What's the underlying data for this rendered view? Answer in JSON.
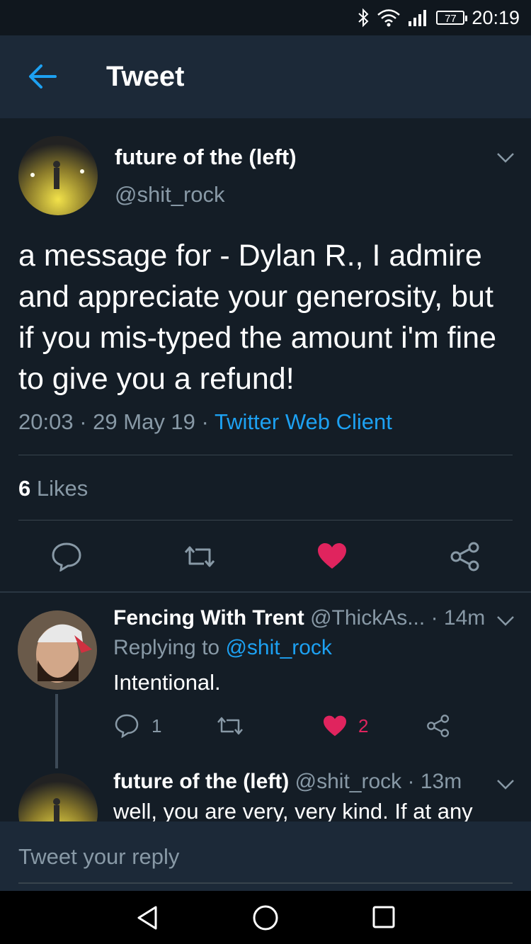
{
  "status_bar": {
    "bluetooth_icon": "bluetooth-icon",
    "wifi_icon": "wifi-icon",
    "signal_icon": "signal-icon",
    "battery": "77",
    "time": "20:19"
  },
  "header": {
    "title": "Tweet"
  },
  "tweet": {
    "author_name": "future of the (left)",
    "author_handle": "@shit_rock",
    "text": "a message for - Dylan R., I admire and appreciate your generosity, but if you mis-typed the amount i'm fine to give you a refund!",
    "time": "20:03",
    "date": "29 May 19",
    "separator": "·",
    "client": "Twitter Web Client",
    "likes_count": "6",
    "likes_label": "Likes"
  },
  "replies": [
    {
      "name": "Fencing With Trent",
      "handle": "@ThickAs...",
      "age": "14m",
      "replying_label": "Replying to",
      "replying_to": "@shit_rock",
      "text": "Intentional.",
      "reply_count": "1",
      "like_count": "2"
    },
    {
      "name": "future of the (left)",
      "handle": "@shit_rock",
      "age": "13m",
      "text": "well, you are very, very kind. If at any"
    }
  ],
  "reply_bar": {
    "placeholder": "Tweet your reply"
  },
  "colors": {
    "background": "#141d26",
    "header": "#1c2938",
    "accent": "#1da1f2",
    "like": "#e0245e",
    "muted": "#8899a6"
  }
}
